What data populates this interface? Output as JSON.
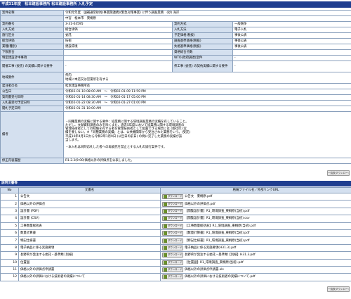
{
  "header": {
    "title": "平成31年度　松本建設事務所 松本建設事務所 入札予定"
  },
  "info": {
    "rows": [
      {
        "label": "案件名称",
        "value": "令和元年度　国補通常砂防(事業関連携)(緊急対策事業) に伴う調査業務　(砂) 海岸",
        "value2": "中宮　松本市　東桐原",
        "span": true
      },
      {
        "label": "契約番号",
        "value": "3-31-04595",
        "label2": "契約方式",
        "value2b": "一般競争"
      },
      {
        "label": "入札方式",
        "value": "総合評価",
        "label2": "入札方法",
        "value2b": "電子入札"
      },
      {
        "label": "施行区分",
        "value": "委託",
        "label2": "予定価格(税抜)",
        "value2b": "事後公表"
      },
      {
        "label": "総合評価",
        "value": "技術",
        "label2": "調査基準価格(税抜)",
        "value2b": "事後公表"
      },
      {
        "label": "業種(種別)",
        "value": "建設環境",
        "label2": "失格基準価格(税抜)",
        "value2b": "事後公表"
      },
      {
        "label": "下限割合",
        "value": "",
        "label2": "資格総合点数",
        "value2b": ""
      },
      {
        "label": "特定建設計中事項",
        "value": "",
        "label2": "WTO(政府調達)案件",
        "value2b": "-"
      },
      {
        "label": "開催工事 (委託) の実績に関する要件",
        "value": "-",
        "label2": "県工事 (委託) の契約実績に関する要件",
        "value2b": "-"
      }
    ],
    "region_label": "地域要件",
    "region_value_1": "県内",
    "region_value_2": "地域に本店又は営業所を有する",
    "orderer_label": "発注者の長",
    "orderer_value": "松本建設事務所長",
    "dates": [
      {
        "label": "公告日",
        "value": "令和02-01-10 08:00 AM　～　令和02-01-09 11:59 PM"
      },
      {
        "label": "質問書受付日時",
        "value": "令和02-01-14 08:30 AM　～　令和02-01-17 05:00 PM"
      },
      {
        "label": "入札書受付予定日時",
        "value": "令和02-01-22 08:30 AM　～　令和02-01-27 01:00 PM"
      },
      {
        "label": "開札予定日時",
        "value": "令和02-01-31 10:00 AM"
      }
    ],
    "notes_label": "備考",
    "notes_lines": [
      "・同種業務の実績に関する要件：協業務に関する環境調査業務の実績を有していること。",
      "ただし、文献資料調査のみを除くまた、過去5年度において協業務に関する環境調査の",
      "管理技術者としての経験を有する者を管理技術者として配置できる場合には (会社の) 実",
      "績を要しない。※「同種業務の実績」とは、公共機関等から受注された業務をいう。(受託)",
      "平成16年4月1日から令和2年1月9日 (公告日の前日) の間に完了した業務の実績が該",
      "当します。",
      "",
      "・本入札は同時応札した者への再委託を禁止とする入札の試行案件です。"
    ],
    "revise_label": "修正内容履歴",
    "revise_value": "R1.2.3(9:00)価格以外の評価点を公表しました。"
  },
  "buttons": {
    "top_btn_1": "一覧表ダウンロード",
    "top_btn_2": "一覧表ダウンロード"
  },
  "docs": {
    "section_title": "説明文書等",
    "headers": {
      "no": "No",
      "name": "文書名",
      "file": "格納ファイル名／外部リンクURL"
    },
    "download_label": "ダウンロード",
    "rows": [
      {
        "no": "1",
        "name": "公告文",
        "file": "公告文　東桐原.pdf"
      },
      {
        "no": "2",
        "name": "価格以外の評価点",
        "file": "価格以外の評価点.pdf"
      },
      {
        "no": "3",
        "name": "設計書 (PDF)",
        "file": "【閲覧設計書】R1_環境調査_東桐原(当初).pdf"
      },
      {
        "no": "4",
        "name": "設計書 (CSV)",
        "file": "【閲覧設計書】R1_環境調査_東桐原(当初).csv"
      },
      {
        "no": "5",
        "name": "工事数量総括表",
        "file": "【工事数量総括表】R1_環境調査_東桐原(当初).pdf"
      },
      {
        "no": "6",
        "name": "数量計算書",
        "file": "【数量計算書】R1_環境調査_東桐原(当初).pdf"
      },
      {
        "no": "7",
        "name": "特記仕様書",
        "file": "【特記仕様書】R1_環境調査_東桐原(当初).pdf"
      },
      {
        "no": "8",
        "name": "電子納品に係る実施要領",
        "file": "電子納品に係る実施要領(H31.3).pdf"
      },
      {
        "no": "9",
        "name": "長野県が発注する委託・基準類 [別紙]",
        "file": "長野県が発注する委託・基準類【別紙】H31.3.pdf"
      },
      {
        "no": "10",
        "name": "位置図",
        "file": "【位置図】R1_環境調査_東桐原(当初).pdf"
      },
      {
        "no": "11",
        "name": "価格以外の評価点申請書",
        "file": "価格以外の評価点申請書.xls"
      },
      {
        "no": "12",
        "name": "価格以外の評価における技術者の実績について",
        "file": "価格以外の評価における技術者の実績について.pdf"
      }
    ]
  }
}
